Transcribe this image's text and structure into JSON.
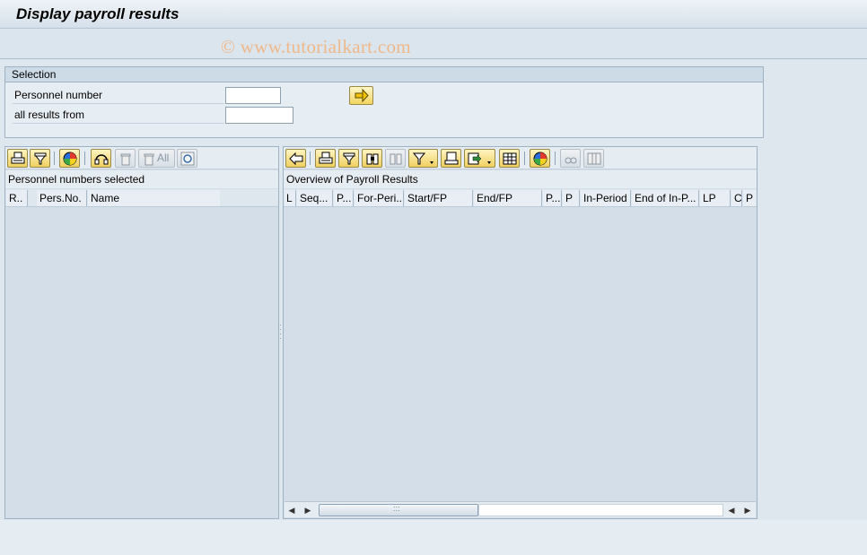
{
  "window": {
    "title": "Display payroll results",
    "watermark": "© www.tutorialkart.com"
  },
  "selection": {
    "header": "Selection",
    "fields": [
      {
        "label": "Personnel number",
        "value": ""
      },
      {
        "label": "all results from",
        "value": ""
      }
    ],
    "execute_icon": "arrow-right-icon"
  },
  "left_panel": {
    "toolbar_icons": [
      "print-icon",
      "filter-icon",
      "color-wheel-icon",
      "headset-icon",
      "delete-icon",
      "delete-all-icon",
      "refresh-icon"
    ],
    "delete_all_label": "All",
    "title": "Personnel numbers selected",
    "columns": [
      "R..",
      "Pers.No.",
      "Name"
    ]
  },
  "right_panel": {
    "toolbar_icons": [
      "back-arrow-icon",
      "print-icon",
      "filter-icon",
      "find-icon",
      "find-next-icon",
      "filter-dropdown-icon",
      "print-preview-icon",
      "export-icon",
      "table-icon",
      "color-wheel-icon",
      "glasses-icon",
      "columns-icon"
    ],
    "title": "Overview of Payroll Results",
    "columns": [
      "L",
      "Seq...",
      "P...",
      "For-Peri...",
      "Start/FP",
      "End/FP",
      "P...",
      "P",
      "In-Period",
      "End of In-P...",
      "LP",
      "C",
      "P"
    ],
    "scroll_grip": ":::"
  }
}
